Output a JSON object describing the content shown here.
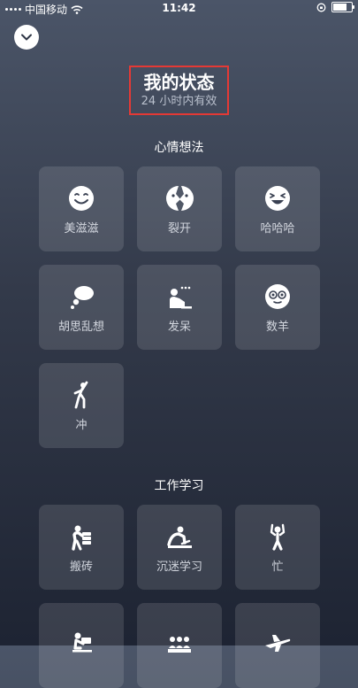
{
  "status_bar": {
    "carrier": "中国移动",
    "time": "11:42"
  },
  "header": {
    "title": "我的状态",
    "subtitle": "24 小时内有效"
  },
  "sections": [
    {
      "title": "心情想法",
      "items": [
        {
          "label": "美滋滋",
          "icon": "smile-icon"
        },
        {
          "label": "裂开",
          "icon": "cracked-face-icon"
        },
        {
          "label": "哈哈哈",
          "icon": "laughing-face-icon"
        },
        {
          "label": "胡思乱想",
          "icon": "thought-bubble-icon"
        },
        {
          "label": "发呆",
          "icon": "daydream-person-icon"
        },
        {
          "label": "数羊",
          "icon": "sheep-face-icon"
        },
        {
          "label": "冲",
          "icon": "charging-person-icon"
        }
      ]
    },
    {
      "title": "工作学习",
      "items": [
        {
          "label": "搬砖",
          "icon": "carrying-bricks-icon"
        },
        {
          "label": "沉迷学习",
          "icon": "studying-person-icon"
        },
        {
          "label": "忙",
          "icon": "busy-person-icon"
        },
        {
          "label": "",
          "icon": "desk-person-icon"
        },
        {
          "label": "",
          "icon": "meeting-icon"
        },
        {
          "label": "",
          "icon": "airplane-icon"
        }
      ]
    }
  ]
}
